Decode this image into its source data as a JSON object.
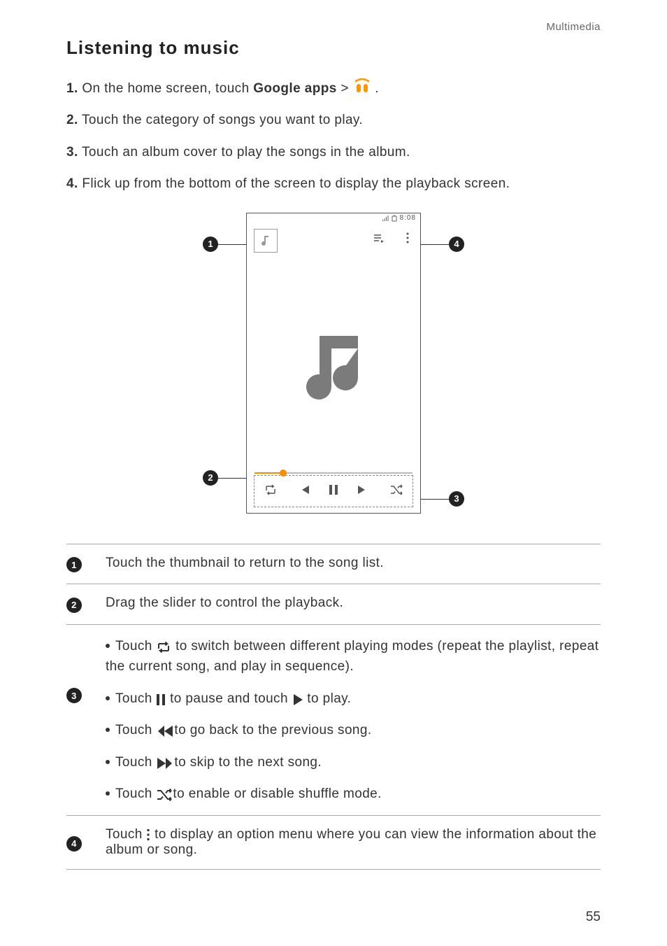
{
  "header": {
    "section": "Multimedia"
  },
  "title": "Listening to music",
  "steps": {
    "s1": {
      "num": "1.",
      "a": "On the home screen, touch ",
      "b": "Google apps",
      "c": " > ",
      "d": " ."
    },
    "s2": {
      "num": "2.",
      "text": "Touch the category of songs you want to play."
    },
    "s3": {
      "num": "3.",
      "text": "Touch an album cover to play the songs in the album."
    },
    "s4": {
      "num": "4.",
      "text": "Flick up from the bottom of the screen to display the playback screen."
    }
  },
  "statusbar_text": "8:08",
  "table": {
    "r1": "Touch the thumbnail to return to the song list.",
    "r2": "Drag the slider to control the playback.",
    "r3": {
      "b1a": "Touch ",
      "b1b": " to switch between different playing modes (repeat the playlist, repeat the current song, and play in sequence).",
      "b2a": "Touch ",
      "b2mid": " to pause and touch ",
      "b2end": " to play.",
      "b3a": "Touch ",
      "b3b": "to go back to the previous song.",
      "b4a": "Touch ",
      "b4b": "to skip to the next song.",
      "b5a": "Touch ",
      "b5b": "to enable or disable shuffle mode."
    },
    "r4a": "Touch ",
    "r4b": " to display an option menu where you can view the information about the album or song."
  },
  "page_number": "55"
}
